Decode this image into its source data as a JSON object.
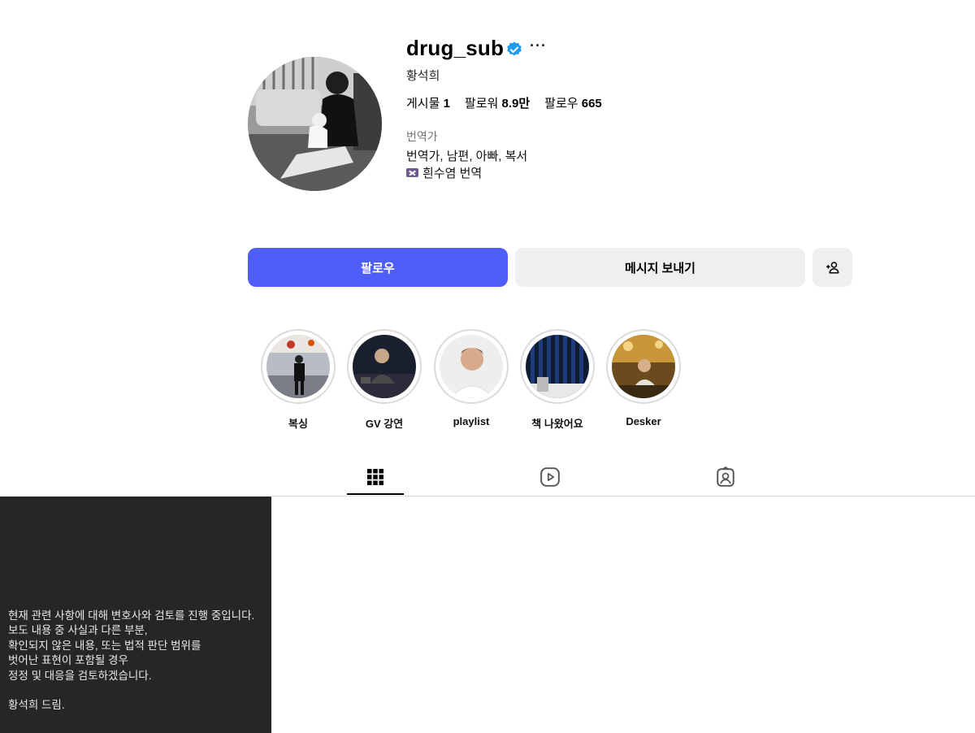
{
  "profile": {
    "username": "drug_sub",
    "more_label": "···",
    "full_name": "황석희",
    "stats": {
      "posts_label": "게시물",
      "posts_value": "1",
      "followers_label": "팔로워",
      "followers_value": "8.9만",
      "following_label": "팔로우",
      "following_value": "665"
    },
    "category": "번역가",
    "bio_line1": "번역가, 남편, 아빠, 복서",
    "bio_line2": "흰수염 번역"
  },
  "actions": {
    "follow_label": "팔로우",
    "message_label": "메시지 보내기",
    "add_user_icon": "add-user-icon"
  },
  "highlights": [
    {
      "label": "복싱"
    },
    {
      "label": "GV 강연"
    },
    {
      "label": "playlist"
    },
    {
      "label": "책 나왔어요"
    },
    {
      "label": "Desker"
    }
  ],
  "tabs": [
    {
      "icon": "grid-icon",
      "active": true
    },
    {
      "icon": "reels-icon",
      "active": false
    },
    {
      "icon": "tagged-icon",
      "active": false
    }
  ],
  "notice": {
    "text": "현재 관련 사항에 대해 변호사와 검토를 진행 중입니다.\n보도 내용 중 사실과 다른 부분,\n확인되지 않은 내용, 또는 법적 판단 범위를\n벗어난 표현이 포함될 경우\n정정 및 대응을 검토하겠습니다.\n\n황석희 드림."
  },
  "colors": {
    "accent": "#4f5ef7",
    "verified": "#1d9bf0",
    "notice_bg": "#262626"
  }
}
